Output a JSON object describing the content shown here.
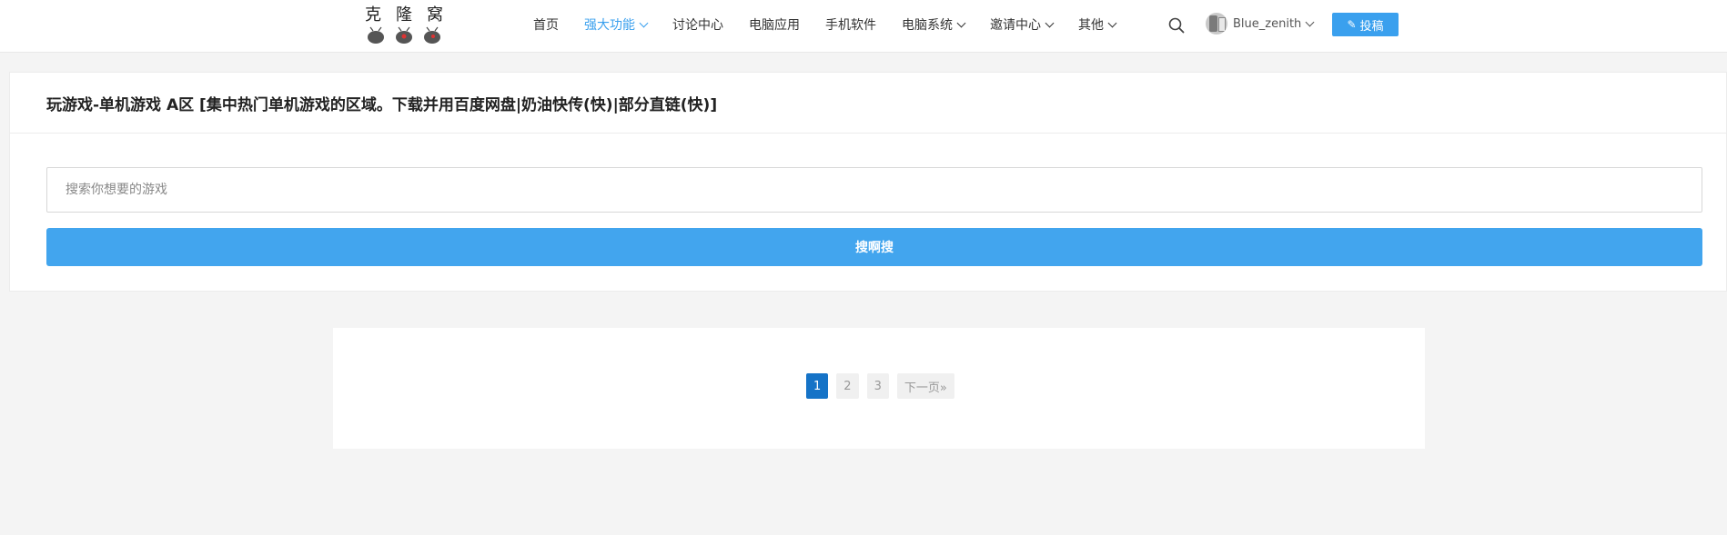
{
  "header": {
    "logo_chars": [
      "克",
      "隆",
      "窝"
    ],
    "nav": [
      {
        "label": "首页",
        "dropdown": false,
        "active": false
      },
      {
        "label": "强大功能",
        "dropdown": true,
        "active": true
      },
      {
        "label": "讨论中心",
        "dropdown": false,
        "active": false
      },
      {
        "label": "电脑应用",
        "dropdown": false,
        "active": false
      },
      {
        "label": "手机软件",
        "dropdown": false,
        "active": false
      },
      {
        "label": "电脑系统",
        "dropdown": true,
        "active": false
      },
      {
        "label": "邀请中心",
        "dropdown": true,
        "active": false
      },
      {
        "label": "其他",
        "dropdown": true,
        "active": false
      }
    ],
    "username": "Blue_zenith",
    "post_label": "投稿"
  },
  "section": {
    "title": "玩游戏-单机游戏 A区 [集中热门单机游戏的区域。下载并用百度网盘|奶油快传(快)|部分直链(快)]",
    "search_placeholder": "搜索你想要的游戏",
    "search_button": "搜啊搜"
  },
  "pagination": {
    "pages": [
      "1",
      "2",
      "3"
    ],
    "current": "1",
    "next_label": "下一页»"
  },
  "colors": {
    "accent": "#3aa0ee",
    "search_button": "#42a5ee",
    "current_page": "#1573c7"
  }
}
